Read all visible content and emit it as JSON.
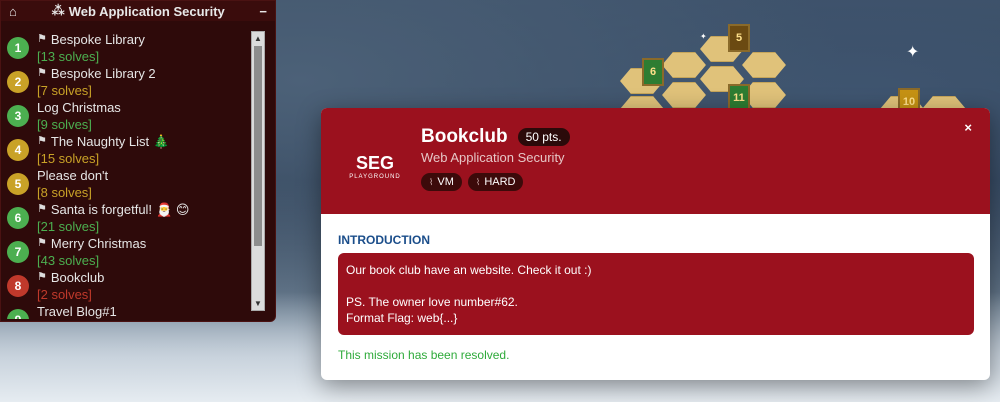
{
  "panel": {
    "title": "Web Application Security",
    "collapse_label": "−",
    "items": [
      {
        "num": "1",
        "title": "Bespoke Library",
        "solves": "[13 solves]",
        "flag": true,
        "emoji": "",
        "color": "green"
      },
      {
        "num": "2",
        "title": "Bespoke Library 2",
        "solves": "[7 solves]",
        "flag": true,
        "emoji": "",
        "color": "gold"
      },
      {
        "num": "3",
        "title": "Log Christmas",
        "solves": "[9 solves]",
        "flag": false,
        "emoji": "",
        "color": "green"
      },
      {
        "num": "4",
        "title": "The Naughty List",
        "solves": "[15 solves]",
        "flag": true,
        "emoji": "🎄",
        "color": "gold"
      },
      {
        "num": "5",
        "title": "Please don't",
        "solves": "[8 solves]",
        "flag": false,
        "emoji": "",
        "color": "gold"
      },
      {
        "num": "6",
        "title": "Santa is forgetful!",
        "solves": "[21 solves]",
        "flag": true,
        "emoji": "🎅 😊",
        "color": "green"
      },
      {
        "num": "7",
        "title": "Merry Christmas",
        "solves": "[43 solves]",
        "flag": true,
        "emoji": "",
        "color": "green"
      },
      {
        "num": "8",
        "title": "Bookclub",
        "solves": "[2 solves]",
        "flag": true,
        "emoji": "",
        "color": "red"
      },
      {
        "num": "9",
        "title": "Travel Blog#1",
        "solves": "",
        "flag": false,
        "emoji": "",
        "color": "green"
      }
    ]
  },
  "modal": {
    "logo_text": "SEG",
    "logo_sub": "PLAYGROUND",
    "title": "Bookclub",
    "points": "50 pts.",
    "category": "Web Application Security",
    "tags": [
      "VM",
      "HARD"
    ],
    "close_label": "×",
    "intro_label": "INTRODUCTION",
    "intro_lines": [
      "Our book club have an website. Check it out :)",
      "",
      "PS. The owner love number#62.",
      "Format Flag: web{...}"
    ],
    "resolved_text": "This mission has been resolved."
  },
  "map": {
    "banners": [
      "5",
      "6",
      "11",
      "10"
    ]
  },
  "colors": {
    "accent_red": "#9b111e",
    "solved_green": "#4caf50",
    "gold": "#c9a227"
  }
}
